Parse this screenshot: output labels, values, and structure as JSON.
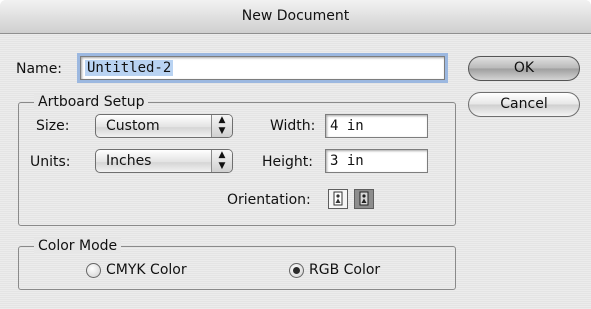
{
  "window": {
    "title": "New Document"
  },
  "name": {
    "label": "Name:",
    "value": "Untitled-2"
  },
  "buttons": {
    "ok": "OK",
    "cancel": "Cancel"
  },
  "artboard": {
    "legend": "Artboard Setup",
    "size_label": "Size:",
    "size_value": "Custom",
    "units_label": "Units:",
    "units_value": "Inches",
    "width_label": "Width:",
    "width_value": "4 in",
    "height_label": "Height:",
    "height_value": "3 in",
    "orientation_label": "Orientation:",
    "orientation_options": [
      "portrait",
      "landscape"
    ],
    "orientation_selected": "landscape"
  },
  "color_mode": {
    "legend": "Color Mode",
    "options": [
      {
        "label": "CMYK Color",
        "selected": false
      },
      {
        "label": "RGB Color",
        "selected": true
      }
    ]
  },
  "icons": {
    "popup_arrows": "▲▼",
    "portrait": "⎕",
    "landscape": "⎕"
  }
}
